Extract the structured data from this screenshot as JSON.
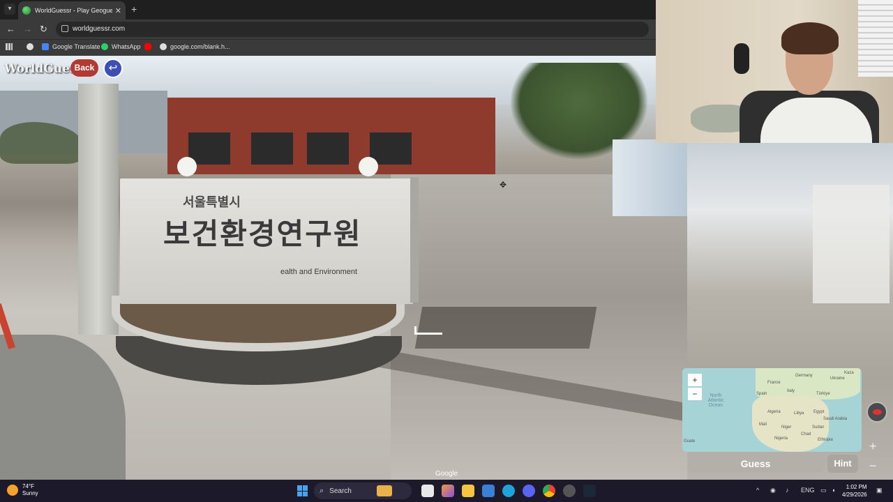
{
  "browser": {
    "tab_title": "WorldGuessr - Play Geoguessr F",
    "close_glyph": "✕",
    "newtab_glyph": "+",
    "url": "worldguessr.com",
    "nav": {
      "back_glyph": "←",
      "forward_glyph": "→",
      "reload_glyph": "↻"
    },
    "bookmarks": [
      {
        "label": "Google Translate",
        "icon": "translate-icon",
        "color": "#4285f4"
      },
      {
        "label": "WhatsApp",
        "icon": "whatsapp-icon",
        "color": "#25d366"
      },
      {
        "label": "",
        "icon": "youtube-icon",
        "color": "#ff0000"
      },
      {
        "label": "google.com/blank.h...",
        "icon": "google-icon",
        "color": "#dddddd"
      }
    ]
  },
  "game": {
    "logo": "WorldGuessr",
    "back_label": "Back",
    "return_glyph": "↩",
    "guess_label": "Guess",
    "hint_label": "Hint",
    "zoom_in": "+",
    "zoom_out": "−"
  },
  "scene": {
    "sign_korean_small": "서울특별시",
    "sign_korean_large": "보건환경연구원",
    "sign_english": "ealth and Environment",
    "watermark": "Google"
  },
  "map": {
    "ocean_label": "North Atlantic Ocean",
    "countries": [
      "Germany",
      "Ukraine",
      "France",
      "Spain",
      "Italy",
      "Türkiye",
      "Algeria",
      "Libya",
      "Egypt",
      "Saudi Arabia",
      "Mali",
      "Niger",
      "Sudan",
      "Nigeria",
      "Chad",
      "Ethiopia",
      "Kaza",
      "Guate"
    ]
  },
  "taskbar": {
    "weather_temp": "74°F",
    "weather_cond": "Sunny",
    "search_label": "Search",
    "lang": "ENG",
    "time": "1:02 PM",
    "date": "4/29/2026"
  }
}
